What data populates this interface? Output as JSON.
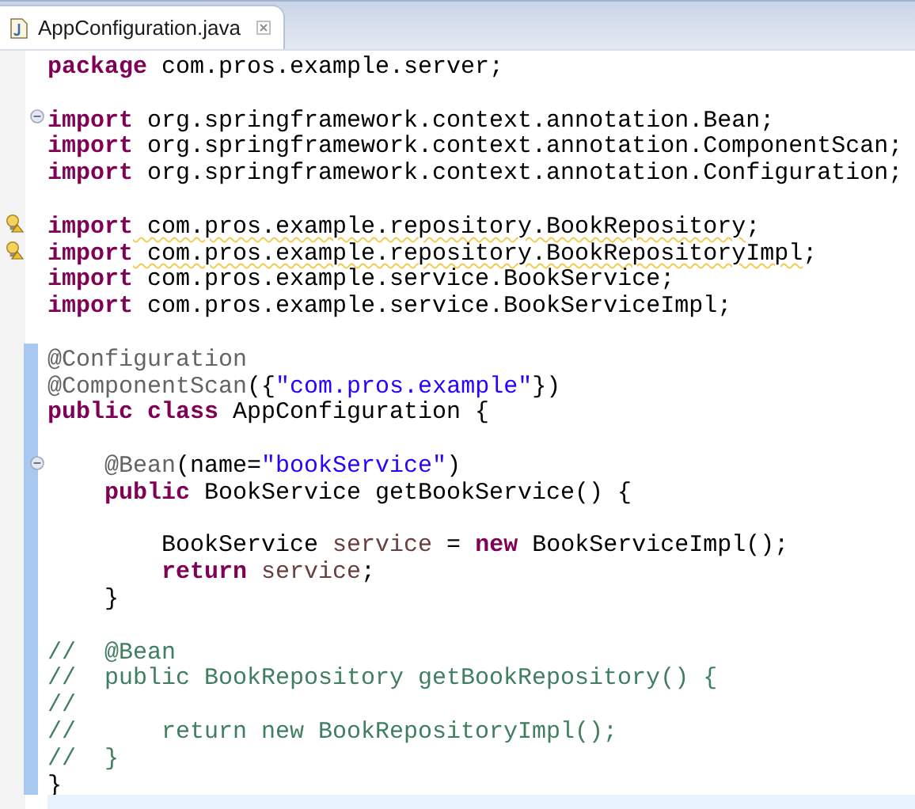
{
  "tab": {
    "title": "AppConfiguration.java",
    "selected": true
  },
  "lines": [
    {
      "foldable": false,
      "warning": false,
      "in_range": false,
      "current": false,
      "tokens": [
        {
          "kind": "keyword",
          "text": "package"
        },
        {
          "kind": "plain",
          "text": " com.pros.example.server;"
        }
      ]
    },
    {
      "foldable": false,
      "warning": false,
      "in_range": false,
      "current": false
    },
    {
      "foldable": true,
      "warning": false,
      "in_range": false,
      "current": false,
      "tokens": [
        {
          "kind": "keyword",
          "text": "import"
        },
        {
          "kind": "plain",
          "text": " org.springframework.context.annotation.Bean;"
        }
      ]
    },
    {
      "foldable": false,
      "warning": false,
      "in_range": false,
      "current": false,
      "tokens": [
        {
          "kind": "keyword",
          "text": "import"
        },
        {
          "kind": "plain",
          "text": " org.springframework.context.annotation.ComponentScan;"
        }
      ]
    },
    {
      "foldable": false,
      "warning": false,
      "in_range": false,
      "current": false,
      "tokens": [
        {
          "kind": "keyword",
          "text": "import"
        },
        {
          "kind": "plain",
          "text": " org.springframework.context.annotation.Configuration;"
        }
      ]
    },
    {
      "foldable": false,
      "warning": false,
      "in_range": false,
      "current": false
    },
    {
      "foldable": false,
      "warning": true,
      "in_range": false,
      "current": false,
      "tokens": [
        {
          "kind": "keyword",
          "text": "import"
        },
        {
          "kind": "plain",
          "text": " com.pros.example.repository.BookRepository",
          "warning": true
        },
        {
          "kind": "plain",
          "text": ";"
        }
      ]
    },
    {
      "foldable": false,
      "warning": true,
      "in_range": false,
      "current": false,
      "tokens": [
        {
          "kind": "keyword",
          "text": "import"
        },
        {
          "kind": "plain",
          "text": " com.pros.example.repository.BookRepositoryImpl",
          "warning": true
        },
        {
          "kind": "plain",
          "text": ";"
        }
      ]
    },
    {
      "foldable": false,
      "warning": false,
      "in_range": false,
      "current": false,
      "tokens": [
        {
          "kind": "keyword",
          "text": "import"
        },
        {
          "kind": "plain",
          "text": " com.pros.example.service.BookService;"
        }
      ]
    },
    {
      "foldable": false,
      "warning": false,
      "in_range": false,
      "current": false,
      "tokens": [
        {
          "kind": "keyword",
          "text": "import"
        },
        {
          "kind": "plain",
          "text": " com.pros.example.service.BookServiceImpl;"
        }
      ]
    },
    {
      "foldable": false,
      "warning": false,
      "in_range": false,
      "current": false
    },
    {
      "foldable": false,
      "warning": false,
      "in_range": true,
      "current": false,
      "tokens": [
        {
          "kind": "annotation",
          "text": "@Configuration"
        }
      ]
    },
    {
      "foldable": false,
      "warning": false,
      "in_range": true,
      "current": false,
      "tokens": [
        {
          "kind": "annotation",
          "text": "@ComponentScan"
        },
        {
          "kind": "plain",
          "text": "({"
        },
        {
          "kind": "string",
          "text": "\"com.pros.example\""
        },
        {
          "kind": "plain",
          "text": "})"
        }
      ]
    },
    {
      "foldable": false,
      "warning": false,
      "in_range": true,
      "current": false,
      "tokens": [
        {
          "kind": "keyword",
          "text": "public"
        },
        {
          "kind": "keyword",
          "text": " class"
        },
        {
          "kind": "plain",
          "text": " AppConfiguration {"
        }
      ]
    },
    {
      "foldable": false,
      "warning": false,
      "in_range": true,
      "current": false
    },
    {
      "foldable": true,
      "warning": false,
      "in_range": true,
      "current": false,
      "tokens": [
        {
          "kind": "annotation",
          "text": "    @Bean"
        },
        {
          "kind": "plain",
          "text": "(name="
        },
        {
          "kind": "string",
          "text": "\"bookService\""
        },
        {
          "kind": "plain",
          "text": ")"
        }
      ]
    },
    {
      "foldable": false,
      "warning": false,
      "in_range": true,
      "current": false,
      "tokens": [
        {
          "kind": "keyword",
          "text": "    public"
        },
        {
          "kind": "plain",
          "text": " BookService getBookService() {"
        }
      ]
    },
    {
      "foldable": false,
      "warning": false,
      "in_range": true,
      "current": false
    },
    {
      "foldable": false,
      "warning": false,
      "in_range": true,
      "current": false,
      "tokens": [
        {
          "kind": "plain",
          "text": "        BookService "
        },
        {
          "kind": "variable",
          "text": "service"
        },
        {
          "kind": "plain",
          "text": " = "
        },
        {
          "kind": "keyword",
          "text": "new"
        },
        {
          "kind": "plain",
          "text": " BookServiceImpl();"
        }
      ]
    },
    {
      "foldable": false,
      "warning": false,
      "in_range": true,
      "current": false,
      "tokens": [
        {
          "kind": "keyword",
          "text": "        return"
        },
        {
          "kind": "variable",
          "text": " service"
        },
        {
          "kind": "plain",
          "text": ";"
        }
      ]
    },
    {
      "foldable": false,
      "warning": false,
      "in_range": true,
      "current": false,
      "tokens": [
        {
          "kind": "plain",
          "text": "    }"
        }
      ]
    },
    {
      "foldable": false,
      "warning": false,
      "in_range": true,
      "current": false
    },
    {
      "foldable": false,
      "warning": false,
      "in_range": true,
      "current": false,
      "tokens": [
        {
          "kind": "comment",
          "text": "//  @Bean"
        }
      ]
    },
    {
      "foldable": false,
      "warning": false,
      "in_range": true,
      "current": false,
      "tokens": [
        {
          "kind": "comment",
          "text": "//  public BookRepository getBookRepository() {"
        }
      ]
    },
    {
      "foldable": false,
      "warning": false,
      "in_range": true,
      "current": false,
      "tokens": [
        {
          "kind": "comment",
          "text": "//"
        }
      ]
    },
    {
      "foldable": false,
      "warning": false,
      "in_range": true,
      "current": false,
      "tokens": [
        {
          "kind": "comment",
          "text": "//      return new BookRepositoryImpl();"
        }
      ]
    },
    {
      "foldable": false,
      "warning": false,
      "in_range": true,
      "current": false,
      "tokens": [
        {
          "kind": "comment",
          "text": "//  }"
        }
      ]
    },
    {
      "foldable": false,
      "warning": false,
      "in_range": true,
      "current": false,
      "tokens": [
        {
          "kind": "plain",
          "text": "}"
        }
      ]
    },
    {
      "foldable": false,
      "warning": false,
      "in_range": false,
      "current": true
    }
  ]
}
